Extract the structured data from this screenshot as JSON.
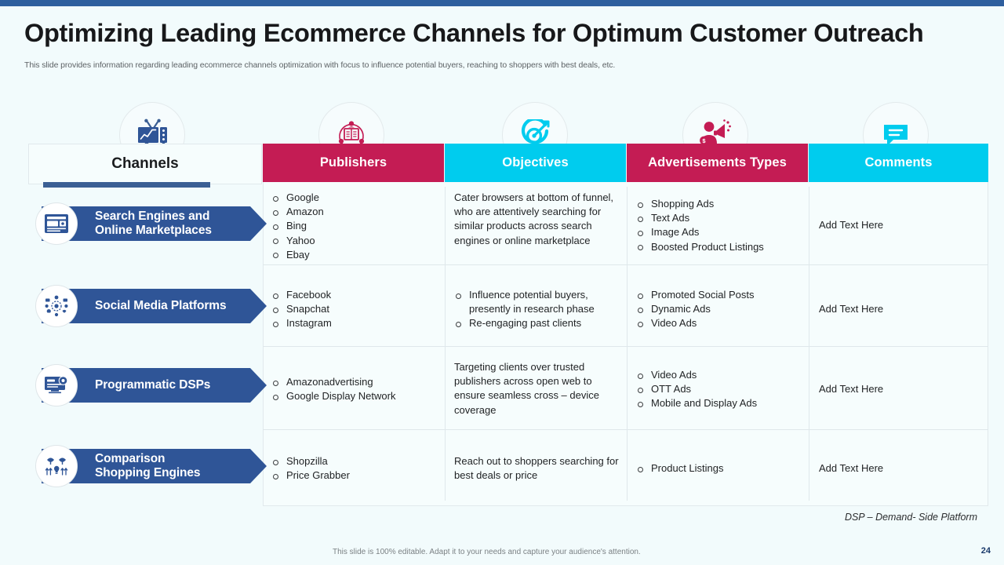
{
  "slide": {
    "title": "Optimizing Leading Ecommerce Channels for Optimum Customer Outreach",
    "subtitle": "This slide provides information regarding leading ecommerce channels optimization with focus to influence potential buyers, reaching to shoppers with best deals, etc.",
    "note": "DSP – Demand- Side Platform",
    "footer_note": "This slide is 100% editable. Adapt it to your needs and capture your audience's attention.",
    "page_number": "24"
  },
  "colors": {
    "top_bar": "#2e5f9e",
    "crimson": "#c41c54",
    "cyan": "#00ccee",
    "chip_blue": "#2f5597",
    "underline_blue": "#3b5f94",
    "background": "#f2fbfc",
    "cell_background": "#f6fdfd"
  },
  "headers": {
    "channels": "Channels",
    "columns": [
      {
        "label": "Publishers",
        "color": "#c41c54",
        "icon": "newspaper-network-icon"
      },
      {
        "label": "Objectives",
        "color": "#00ccee",
        "icon": "target-dart-icon"
      },
      {
        "label": "Advertisements Types",
        "color": "#c41c54",
        "icon": "megaphone-person-icon"
      },
      {
        "label": "Comments",
        "color": "#00ccee",
        "icon": "chat-bubble-icon"
      }
    ],
    "channels_icon": "tv-chart-icon"
  },
  "rows": [
    {
      "channel": {
        "label": "Search Engines and\nOnline Marketplaces",
        "line1": "Search Engines and",
        "line2": "Online Marketplaces",
        "icon": "browser-window-icon"
      },
      "publishers": {
        "type": "list",
        "items": [
          "Google",
          "Amazon",
          "Bing",
          "Yahoo",
          "Ebay"
        ]
      },
      "objectives": {
        "type": "text",
        "text": "Cater browsers at bottom of funnel, who are attentively searching for similar products across search engines or online marketplace"
      },
      "advertisements": {
        "type": "list",
        "items": [
          "Shopping Ads",
          "Text Ads",
          "Image Ads",
          "Boosted Product Listings"
        ]
      },
      "comments": {
        "type": "text",
        "text": "Add Text Here"
      }
    },
    {
      "channel": {
        "label": "Social Media Platforms",
        "line1": "Social Media Platforms",
        "line2": "",
        "icon": "social-network-icon"
      },
      "publishers": {
        "type": "list",
        "items": [
          "Facebook",
          "Snapchat",
          "Instagram"
        ]
      },
      "objectives": {
        "type": "list",
        "items": [
          "Influence potential buyers, presently in research phase",
          "Re-engaging past clients"
        ]
      },
      "advertisements": {
        "type": "list",
        "items": [
          "Promoted Social Posts",
          "Dynamic Ads",
          "Video Ads"
        ]
      },
      "comments": {
        "type": "text",
        "text": "Add Text Here"
      }
    },
    {
      "channel": {
        "label": "Programmatic DSPs",
        "line1": "Programmatic DSPs",
        "line2": "",
        "icon": "monitor-gear-icon"
      },
      "publishers": {
        "type": "list",
        "items": [
          "Amazonadvertising",
          "Google Display Network"
        ]
      },
      "objectives": {
        "type": "text",
        "text": "Targeting clients over trusted publishers across open web to ensure seamless cross – device coverage"
      },
      "advertisements": {
        "type": "list",
        "items": [
          "Video Ads",
          "OTT Ads",
          "Mobile and Display Ads"
        ]
      },
      "comments": {
        "type": "text",
        "text": "Add Text Here"
      }
    },
    {
      "channel": {
        "label": "Comparison\nShopping Engines",
        "line1": "Comparison",
        "line2": "Shopping Engines",
        "icon": "compare-bulb-icon"
      },
      "publishers": {
        "type": "list",
        "items": [
          "Shopzilla",
          "Price Grabber"
        ]
      },
      "objectives": {
        "type": "text",
        "text": "Reach out to shoppers searching for best deals or price"
      },
      "advertisements": {
        "type": "list",
        "items": [
          "Product Listings"
        ]
      },
      "comments": {
        "type": "text",
        "text": "Add Text Here"
      }
    }
  ]
}
